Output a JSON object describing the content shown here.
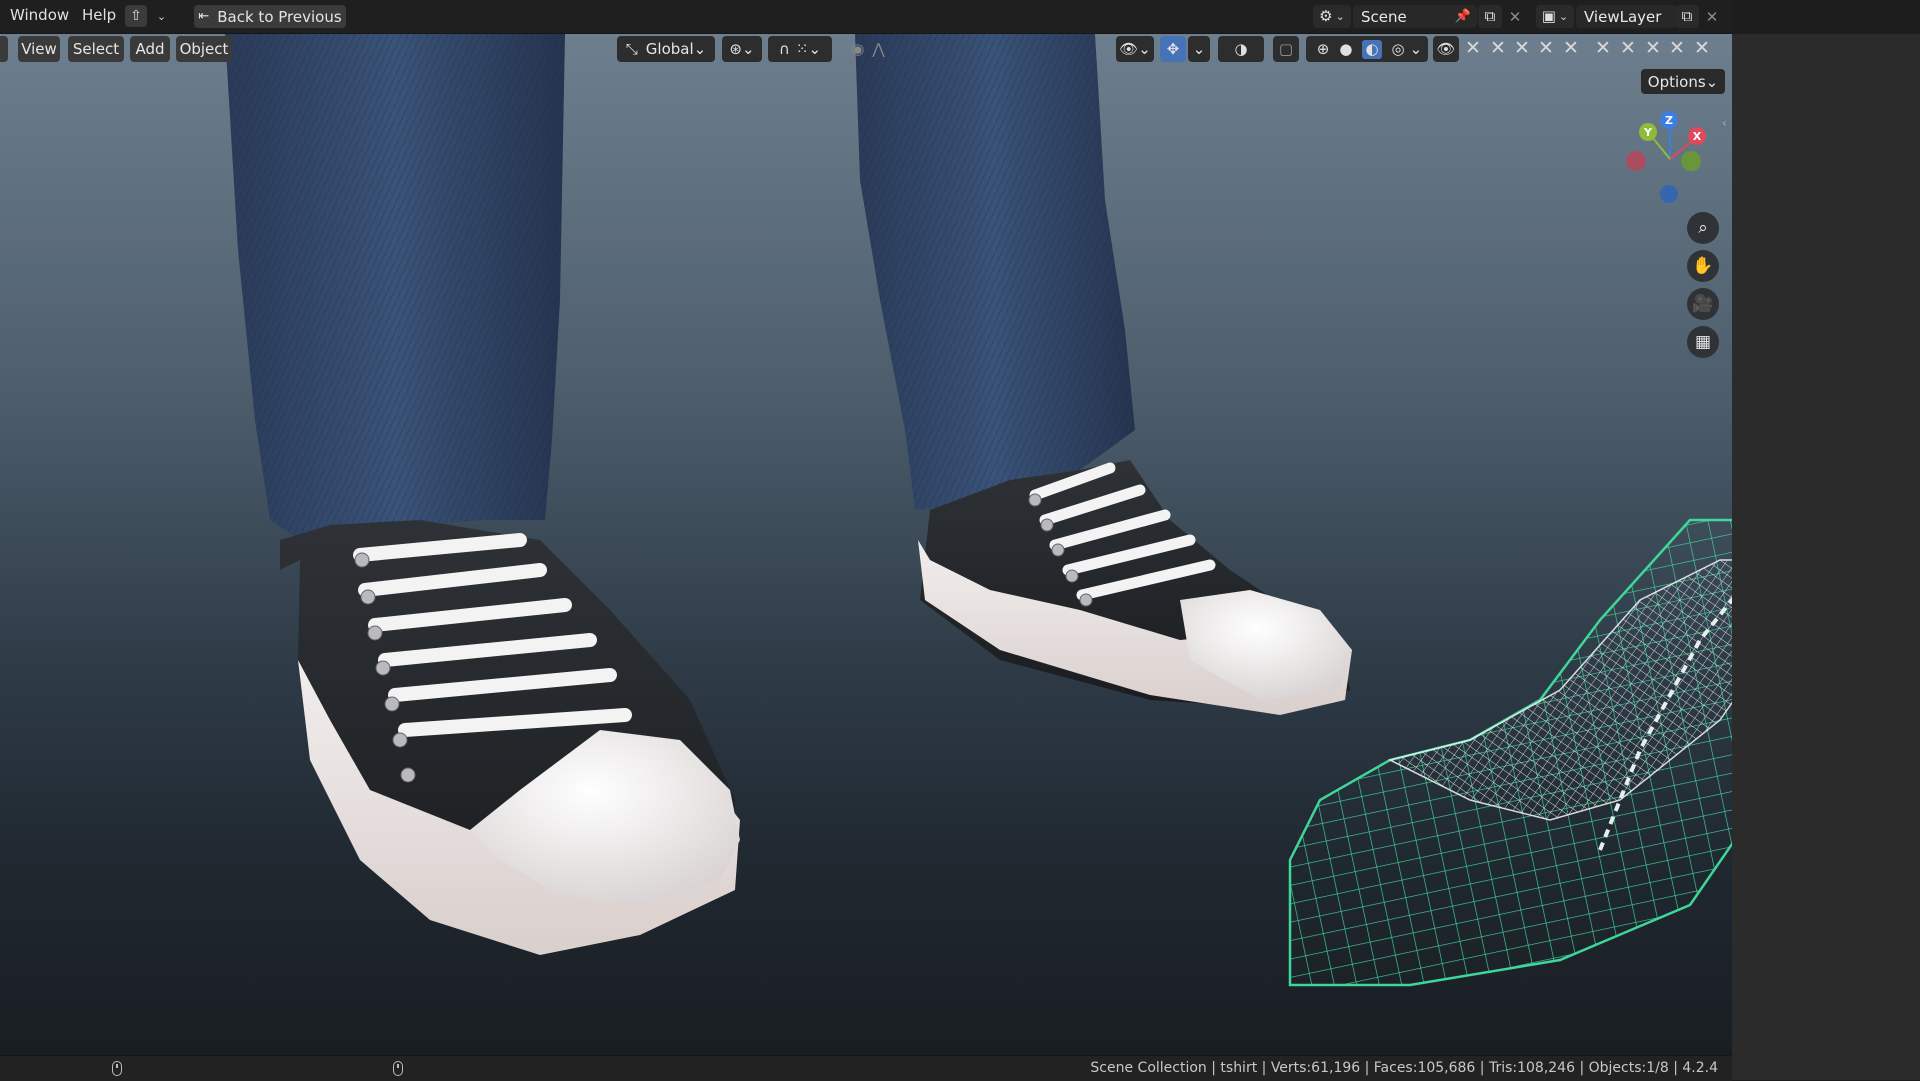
{
  "topbar": {
    "menu_window": "Window",
    "menu_help": "Help",
    "back_to_previous": "Back to Previous",
    "scene_label": "Scene",
    "viewlayer_label": "ViewLayer"
  },
  "viewport_header": {
    "menu_view": "View",
    "menu_select": "Select",
    "menu_add": "Add",
    "menu_object": "Object",
    "transform_orientation": "Global",
    "options_label": "Options"
  },
  "gizmo": {
    "x": "X",
    "y": "Y",
    "z": "Z"
  },
  "statusbar": {
    "text": "Scene Collection | tshirt | Verts:61,196 | Faces:105,686 | Tris:108,246 | Objects:1/8 | 4.2.4"
  },
  "colors": {
    "accent_blue": "#4672b8",
    "wire_green": "#3fd69a",
    "axis_x": "#e0495a",
    "axis_y": "#8bbd3a",
    "axis_z": "#3d7fe0"
  }
}
